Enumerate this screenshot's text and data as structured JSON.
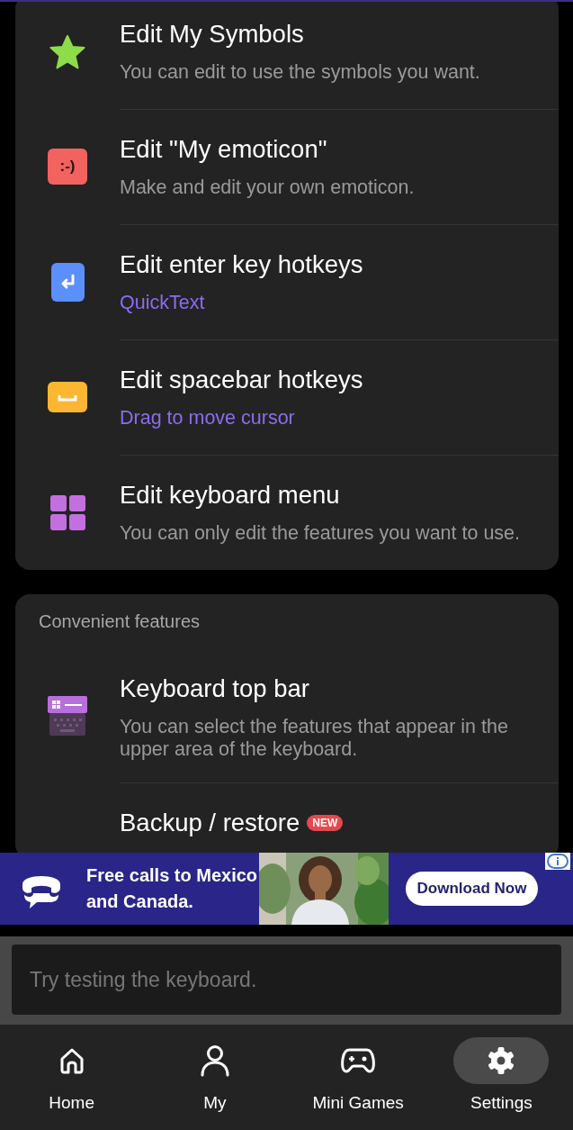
{
  "cards": [
    {
      "items": [
        {
          "kind": "star",
          "title": "Edit My Symbols",
          "subtitle": "You can edit to use the symbols you want."
        },
        {
          "kind": "emoticon",
          "icon_label": ":-)",
          "title": "Edit \"My emoticon\"",
          "subtitle": "Make and edit your own emoticon."
        },
        {
          "kind": "enter",
          "title": "Edit enter key hotkeys",
          "subtitle": "QuickText"
        },
        {
          "kind": "spacebar",
          "title": "Edit spacebar hotkeys",
          "subtitle": "Drag to move cursor"
        },
        {
          "kind": "grid",
          "title": "Edit keyboard menu",
          "subtitle": "You can only edit the features you want to use."
        }
      ]
    },
    {
      "header": "Convenient features",
      "items": [
        {
          "kind": "topbar",
          "title": "Keyboard top bar",
          "subtitle": "You can select the features that appear in the upper area of the keyboard."
        },
        {
          "kind": "backup",
          "title": "Backup / restore",
          "badge": "NEW"
        }
      ]
    }
  ],
  "ad": {
    "headline": "Free calls to Mexico and Canada.",
    "button": "Download Now"
  },
  "test_field": {
    "placeholder": "Try testing the keyboard."
  },
  "nav": [
    {
      "kind": "home",
      "label": "Home",
      "selected": false
    },
    {
      "kind": "profile",
      "label": "My",
      "selected": false
    },
    {
      "kind": "games",
      "label": "Mini Games",
      "selected": false
    },
    {
      "kind": "settings",
      "label": "Settings",
      "selected": true
    }
  ]
}
